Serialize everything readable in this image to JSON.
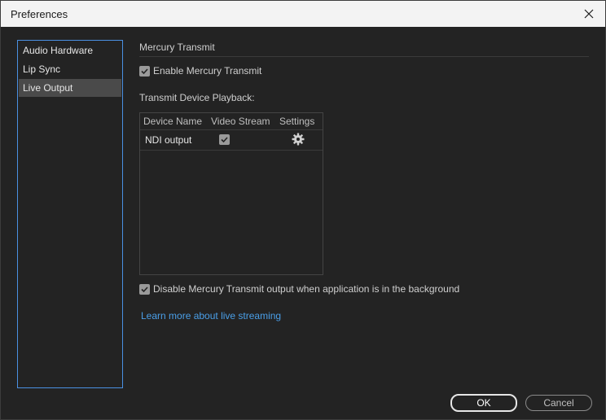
{
  "window": {
    "title": "Preferences"
  },
  "sidebar": {
    "items": [
      {
        "label": "Audio Hardware",
        "selected": false
      },
      {
        "label": "Lip Sync",
        "selected": false
      },
      {
        "label": "Live Output",
        "selected": true
      }
    ]
  },
  "main": {
    "section_title": "Mercury Transmit",
    "enable_label": "Enable Mercury Transmit",
    "enable_checked": true,
    "playback_label": "Transmit Device Playback:",
    "table": {
      "headers": [
        "Device Name",
        "Video Stream",
        "Settings"
      ],
      "rows": [
        {
          "device_name": "NDI output",
          "video_stream": true,
          "settings_icon": "gear-icon"
        }
      ]
    },
    "disable_bg_label": "Disable Mercury Transmit output when application is in the background",
    "disable_bg_checked": true,
    "learn_more_link": "Learn more about live streaming"
  },
  "buttons": {
    "ok": "OK",
    "cancel": "Cancel"
  },
  "colors": {
    "link": "#4a9fe8",
    "focus_border": "#4a90e2",
    "selected_bg": "#4a4a4a"
  }
}
